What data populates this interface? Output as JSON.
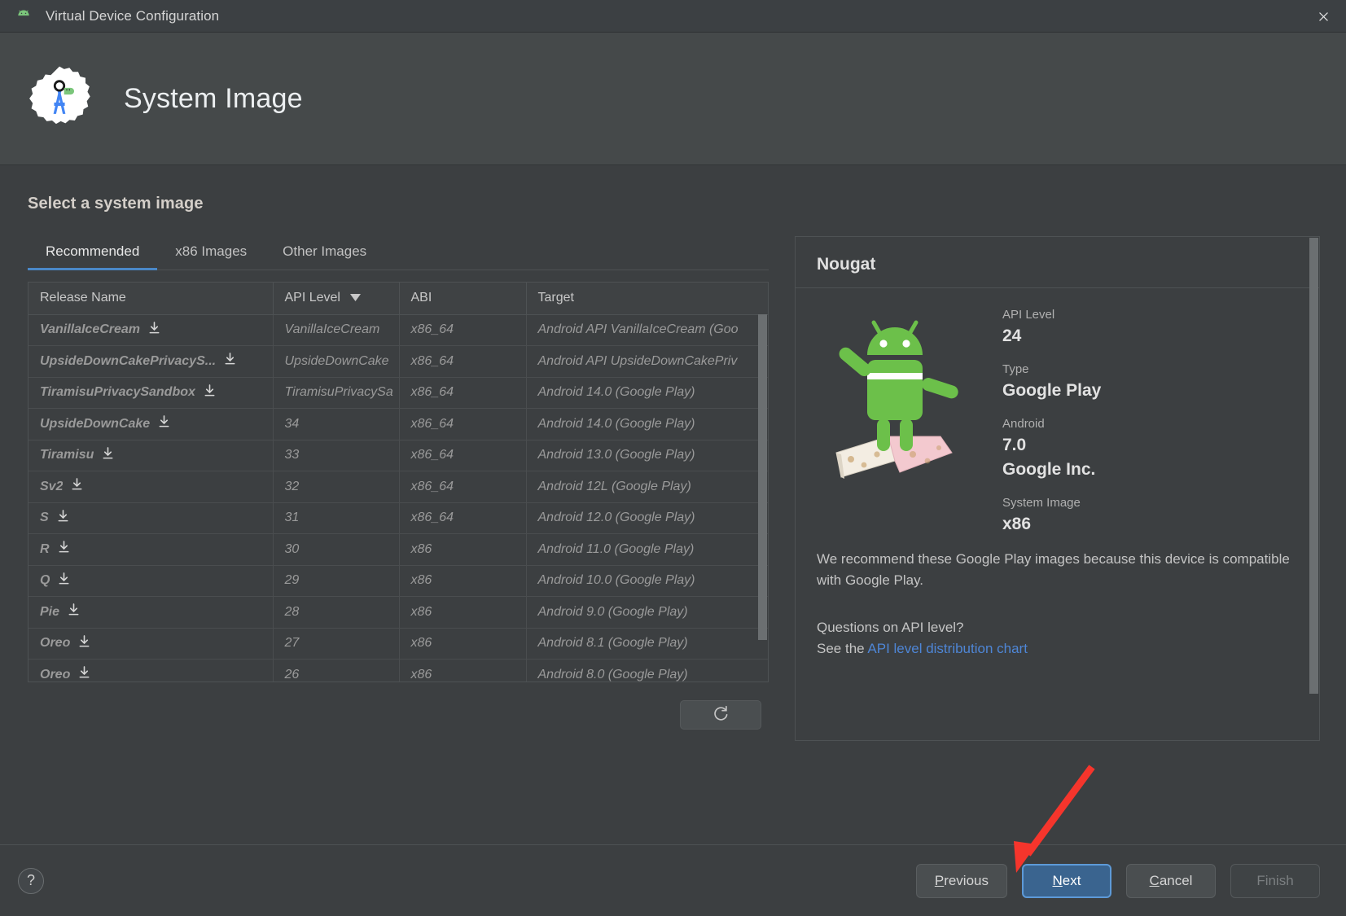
{
  "titlebar": {
    "title": "Virtual Device Configuration",
    "icon": "android-head-icon",
    "close": "close-icon"
  },
  "header": {
    "title": "System Image",
    "logo": "android-studio-logo"
  },
  "main": {
    "section_title": "Select a system image",
    "tabs": [
      {
        "label": "Recommended",
        "active": true
      },
      {
        "label": "x86 Images",
        "active": false
      },
      {
        "label": "Other Images",
        "active": false
      }
    ],
    "table": {
      "columns": [
        "Release Name",
        "API Level",
        "ABI",
        "Target"
      ],
      "sorted_column": "API Level",
      "sort_direction": "desc",
      "rows": [
        {
          "release": "VanillaIceCream",
          "api": "VanillaIceCream",
          "abi": "x86_64",
          "target": "Android API VanillaIceCream (Goo",
          "download": true
        },
        {
          "release": "UpsideDownCakePrivacyS...",
          "api": "UpsideDownCake",
          "abi": "x86_64",
          "target": "Android API UpsideDownCakePriv",
          "download": true
        },
        {
          "release": "TiramisuPrivacySandbox",
          "api": "TiramisuPrivacySa",
          "abi": "x86_64",
          "target": "Android 14.0 (Google Play)",
          "download": true
        },
        {
          "release": "UpsideDownCake",
          "api": "34",
          "abi": "x86_64",
          "target": "Android 14.0 (Google Play)",
          "download": true
        },
        {
          "release": "Tiramisu",
          "api": "33",
          "abi": "x86_64",
          "target": "Android 13.0 (Google Play)",
          "download": true
        },
        {
          "release": "Sv2",
          "api": "32",
          "abi": "x86_64",
          "target": "Android 12L (Google Play)",
          "download": true
        },
        {
          "release": "S",
          "api": "31",
          "abi": "x86_64",
          "target": "Android 12.0 (Google Play)",
          "download": true
        },
        {
          "release": "R",
          "api": "30",
          "abi": "x86",
          "target": "Android 11.0 (Google Play)",
          "download": true
        },
        {
          "release": "Q",
          "api": "29",
          "abi": "x86",
          "target": "Android 10.0 (Google Play)",
          "download": true
        },
        {
          "release": "Pie",
          "api": "28",
          "abi": "x86",
          "target": "Android 9.0 (Google Play)",
          "download": true
        },
        {
          "release": "Oreo",
          "api": "27",
          "abi": "x86",
          "target": "Android 8.1 (Google Play)",
          "download": true
        },
        {
          "release": "Oreo",
          "api": "26",
          "abi": "x86",
          "target": "Android 8.0 (Google Play)",
          "download": true
        }
      ]
    },
    "refresh_icon": "refresh-icon"
  },
  "details": {
    "title": "Nougat",
    "image": "android-nougat-mascot",
    "fields": [
      {
        "label": "API Level",
        "value": "24"
      },
      {
        "label": "Type",
        "value": "Google Play"
      },
      {
        "label": "Android",
        "value": "7.0"
      },
      {
        "label": "",
        "value": "Google Inc."
      },
      {
        "label": "System Image",
        "value": "x86"
      }
    ],
    "recommendation": "We recommend these Google Play images because this device is compatible with Google Play.",
    "question": "Questions on API level?",
    "see_the": "See the ",
    "link_text": "API level distribution chart"
  },
  "footer": {
    "help_label": "?",
    "buttons": [
      {
        "label": "Previous",
        "mnemonic": "P",
        "style": "normal"
      },
      {
        "label": "Next",
        "mnemonic": "N",
        "style": "primary"
      },
      {
        "label": "Cancel",
        "mnemonic": "C",
        "style": "normal"
      },
      {
        "label": "Finish",
        "mnemonic": "",
        "style": "disabled"
      }
    ]
  },
  "annotation": {
    "type": "red-arrow",
    "points_to": "Next",
    "color": "#f5352c"
  },
  "colors": {
    "accent": "#4a88c7",
    "link": "#4e86d6",
    "primary_button": "#3a648f",
    "window_bg": "#3c3f41",
    "header_bg": "#45494a"
  }
}
